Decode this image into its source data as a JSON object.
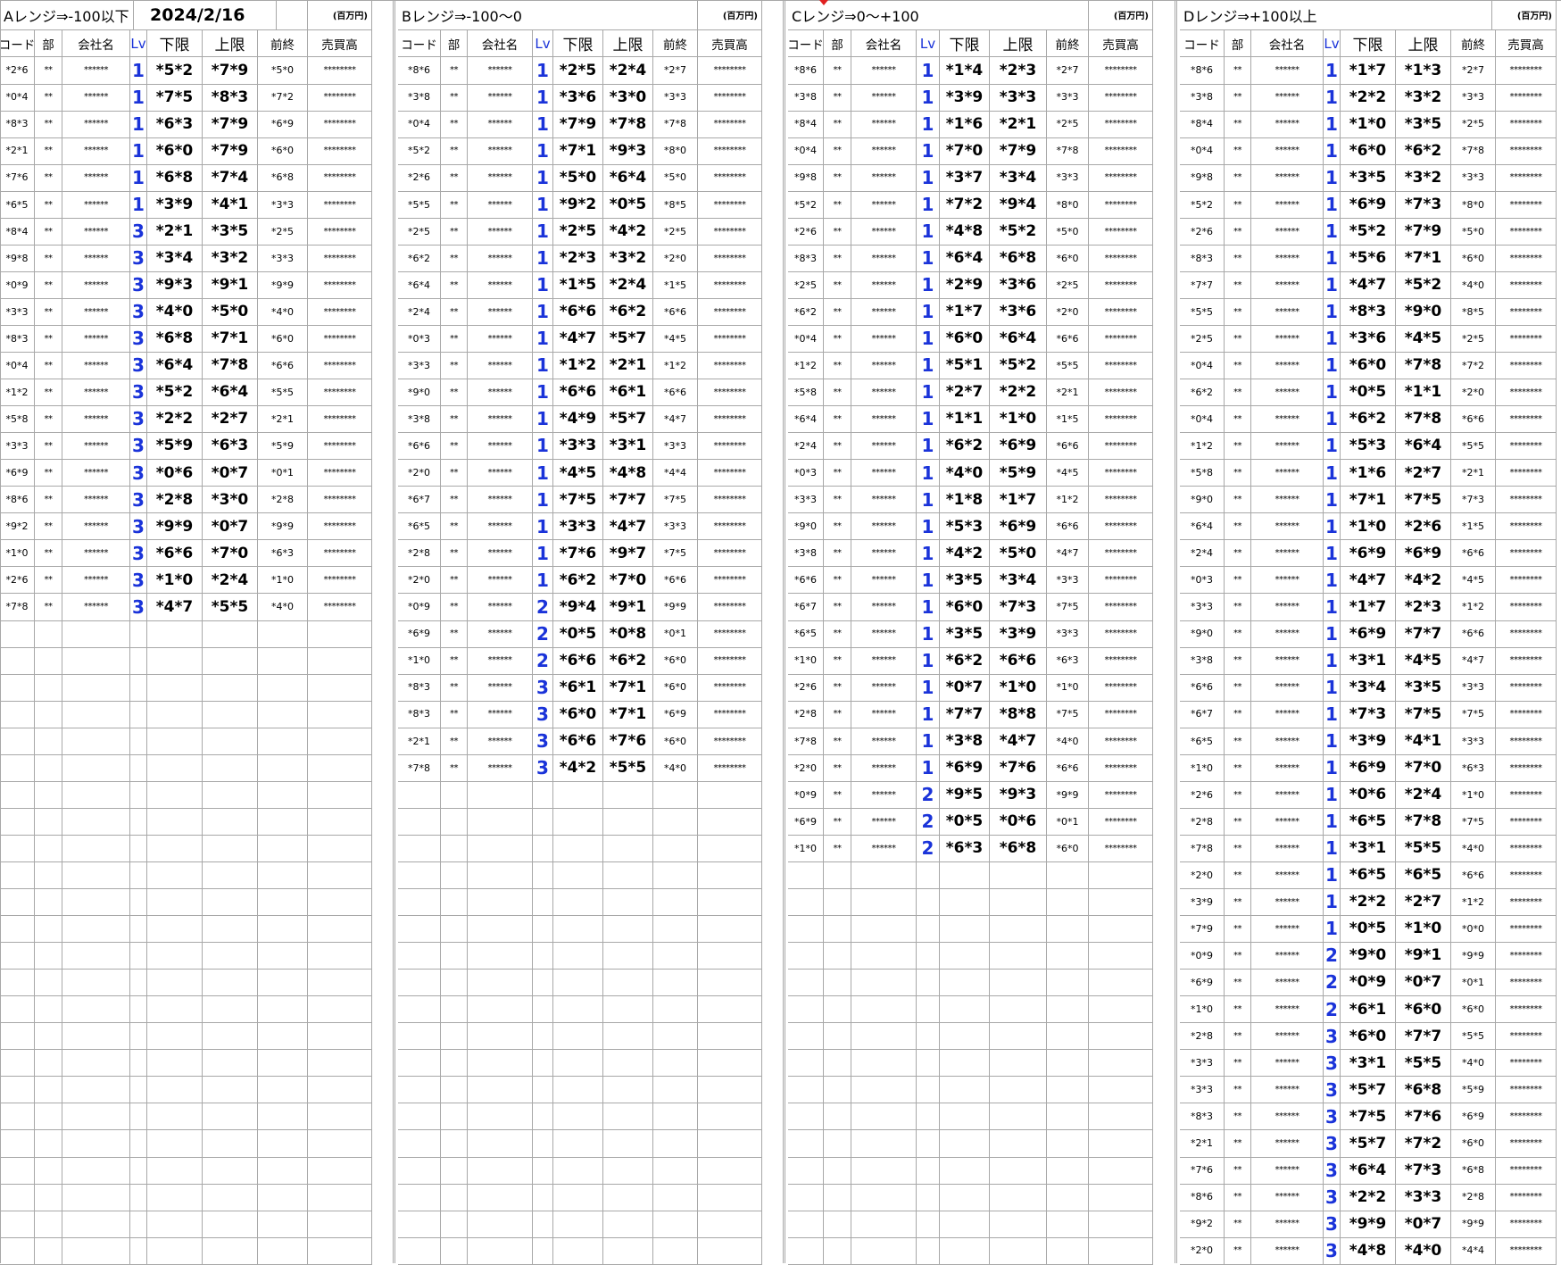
{
  "sheet": {
    "date": "2024/2/16",
    "unit_label": "(百万円)",
    "headers": [
      "コード",
      "部",
      "会社名",
      "Lv",
      "下限",
      "上限",
      "前終",
      "売買高"
    ],
    "mask_company": "******",
    "mask_sector": "**",
    "mask_volume": "********",
    "blocks": [
      {
        "title": "Aレンジ⇒-100以下",
        "rows": [
          [
            "*2*6",
            "1",
            "*5*2",
            "*7*9",
            "*5*0"
          ],
          [
            "*0*4",
            "1",
            "*7*5",
            "*8*3",
            "*7*2"
          ],
          [
            "*8*3",
            "1",
            "*6*3",
            "*7*9",
            "*6*9"
          ],
          [
            "*2*1",
            "1",
            "*6*0",
            "*7*9",
            "*6*0"
          ],
          [
            "*7*6",
            "1",
            "*6*8",
            "*7*4",
            "*6*8"
          ],
          [
            "*6*5",
            "1",
            "*3*9",
            "*4*1",
            "*3*3"
          ],
          [
            "*8*4",
            "3",
            "*2*1",
            "*3*5",
            "*2*5"
          ],
          [
            "*9*8",
            "3",
            "*3*4",
            "*3*2",
            "*3*3"
          ],
          [
            "*0*9",
            "3",
            "*9*3",
            "*9*1",
            "*9*9"
          ],
          [
            "*3*3",
            "3",
            "*4*0",
            "*5*0",
            "*4*0"
          ],
          [
            "*8*3",
            "3",
            "*6*8",
            "*7*1",
            "*6*0"
          ],
          [
            "*0*4",
            "3",
            "*6*4",
            "*7*8",
            "*6*6"
          ],
          [
            "*1*2",
            "3",
            "*5*2",
            "*6*4",
            "*5*5"
          ],
          [
            "*5*8",
            "3",
            "*2*2",
            "*2*7",
            "*2*1"
          ],
          [
            "*3*3",
            "3",
            "*5*9",
            "*6*3",
            "*5*9"
          ],
          [
            "*6*9",
            "3",
            "*0*6",
            "*0*7",
            "*0*1"
          ],
          [
            "*8*6",
            "3",
            "*2*8",
            "*3*0",
            "*2*8"
          ],
          [
            "*9*2",
            "3",
            "*9*9",
            "*0*7",
            "*9*9"
          ],
          [
            "*1*0",
            "3",
            "*6*6",
            "*7*0",
            "*6*3"
          ],
          [
            "*2*6",
            "3",
            "*1*0",
            "*2*4",
            "*1*0"
          ],
          [
            "*7*8",
            "3",
            "*4*7",
            "*5*5",
            "*4*0"
          ]
        ]
      },
      {
        "title": "Bレンジ⇒-100〜0",
        "rows": [
          [
            "*8*6",
            "1",
            "*2*5",
            "*2*4",
            "*2*7"
          ],
          [
            "*3*8",
            "1",
            "*3*6",
            "*3*0",
            "*3*3"
          ],
          [
            "*0*4",
            "1",
            "*7*9",
            "*7*8",
            "*7*8"
          ],
          [
            "*5*2",
            "1",
            "*7*1",
            "*9*3",
            "*8*0"
          ],
          [
            "*2*6",
            "1",
            "*5*0",
            "*6*4",
            "*5*0"
          ],
          [
            "*5*5",
            "1",
            "*9*2",
            "*0*5",
            "*8*5"
          ],
          [
            "*2*5",
            "1",
            "*2*5",
            "*4*2",
            "*2*5"
          ],
          [
            "*6*2",
            "1",
            "*2*3",
            "*3*2",
            "*2*0"
          ],
          [
            "*6*4",
            "1",
            "*1*5",
            "*2*4",
            "*1*5"
          ],
          [
            "*2*4",
            "1",
            "*6*6",
            "*6*2",
            "*6*6"
          ],
          [
            "*0*3",
            "1",
            "*4*7",
            "*5*7",
            "*4*5"
          ],
          [
            "*3*3",
            "1",
            "*1*2",
            "*2*1",
            "*1*2"
          ],
          [
            "*9*0",
            "1",
            "*6*6",
            "*6*1",
            "*6*6"
          ],
          [
            "*3*8",
            "1",
            "*4*9",
            "*5*7",
            "*4*7"
          ],
          [
            "*6*6",
            "1",
            "*3*3",
            "*3*1",
            "*3*3"
          ],
          [
            "*2*0",
            "1",
            "*4*5",
            "*4*8",
            "*4*4"
          ],
          [
            "*6*7",
            "1",
            "*7*5",
            "*7*7",
            "*7*5"
          ],
          [
            "*6*5",
            "1",
            "*3*3",
            "*4*7",
            "*3*3"
          ],
          [
            "*2*8",
            "1",
            "*7*6",
            "*9*7",
            "*7*5"
          ],
          [
            "*2*0",
            "1",
            "*6*2",
            "*7*0",
            "*6*6"
          ],
          [
            "*0*9",
            "2",
            "*9*4",
            "*9*1",
            "*9*9"
          ],
          [
            "*6*9",
            "2",
            "*0*5",
            "*0*8",
            "*0*1"
          ],
          [
            "*1*0",
            "2",
            "*6*6",
            "*6*2",
            "*6*0"
          ],
          [
            "*8*3",
            "3",
            "*6*1",
            "*7*1",
            "*6*0"
          ],
          [
            "*8*3",
            "3",
            "*6*0",
            "*7*1",
            "*6*9"
          ],
          [
            "*2*1",
            "3",
            "*6*6",
            "*7*6",
            "*6*0"
          ],
          [
            "*7*8",
            "3",
            "*4*2",
            "*5*5",
            "*4*0"
          ]
        ]
      },
      {
        "title": "Cレンジ⇒0〜+100",
        "rows": [
          [
            "*8*6",
            "1",
            "*1*4",
            "*2*3",
            "*2*7"
          ],
          [
            "*3*8",
            "1",
            "*3*9",
            "*3*3",
            "*3*3"
          ],
          [
            "*8*4",
            "1",
            "*1*6",
            "*2*1",
            "*2*5"
          ],
          [
            "*0*4",
            "1",
            "*7*0",
            "*7*9",
            "*7*8"
          ],
          [
            "*9*8",
            "1",
            "*3*7",
            "*3*4",
            "*3*3"
          ],
          [
            "*5*2",
            "1",
            "*7*2",
            "*9*4",
            "*8*0"
          ],
          [
            "*2*6",
            "1",
            "*4*8",
            "*5*2",
            "*5*0"
          ],
          [
            "*8*3",
            "1",
            "*6*4",
            "*6*8",
            "*6*0"
          ],
          [
            "*2*5",
            "1",
            "*2*9",
            "*3*6",
            "*2*5"
          ],
          [
            "*6*2",
            "1",
            "*1*7",
            "*3*6",
            "*2*0"
          ],
          [
            "*0*4",
            "1",
            "*6*0",
            "*6*4",
            "*6*6"
          ],
          [
            "*1*2",
            "1",
            "*5*1",
            "*5*2",
            "*5*5"
          ],
          [
            "*5*8",
            "1",
            "*2*7",
            "*2*2",
            "*2*1"
          ],
          [
            "*6*4",
            "1",
            "*1*1",
            "*1*0",
            "*1*5"
          ],
          [
            "*2*4",
            "1",
            "*6*2",
            "*6*9",
            "*6*6"
          ],
          [
            "*0*3",
            "1",
            "*4*0",
            "*5*9",
            "*4*5"
          ],
          [
            "*3*3",
            "1",
            "*1*8",
            "*1*7",
            "*1*2"
          ],
          [
            "*9*0",
            "1",
            "*5*3",
            "*6*9",
            "*6*6"
          ],
          [
            "*3*8",
            "1",
            "*4*2",
            "*5*0",
            "*4*7"
          ],
          [
            "*6*6",
            "1",
            "*3*5",
            "*3*4",
            "*3*3"
          ],
          [
            "*6*7",
            "1",
            "*6*0",
            "*7*3",
            "*7*5"
          ],
          [
            "*6*5",
            "1",
            "*3*5",
            "*3*9",
            "*3*3"
          ],
          [
            "*1*0",
            "1",
            "*6*2",
            "*6*6",
            "*6*3"
          ],
          [
            "*2*6",
            "1",
            "*0*7",
            "*1*0",
            "*1*0"
          ],
          [
            "*2*8",
            "1",
            "*7*7",
            "*8*8",
            "*7*5"
          ],
          [
            "*7*8",
            "1",
            "*3*8",
            "*4*7",
            "*4*0"
          ],
          [
            "*2*0",
            "1",
            "*6*9",
            "*7*6",
            "*6*6"
          ],
          [
            "*0*9",
            "2",
            "*9*5",
            "*9*3",
            "*9*9"
          ],
          [
            "*6*9",
            "2",
            "*0*5",
            "*0*6",
            "*0*1"
          ],
          [
            "*1*0",
            "2",
            "*6*3",
            "*6*8",
            "*6*0"
          ]
        ]
      },
      {
        "title": "Dレンジ⇒+100以上",
        "rows": [
          [
            "*8*6",
            "1",
            "*1*7",
            "*1*3",
            "*2*7"
          ],
          [
            "*3*8",
            "1",
            "*2*2",
            "*3*2",
            "*3*3"
          ],
          [
            "*8*4",
            "1",
            "*1*0",
            "*3*5",
            "*2*5"
          ],
          [
            "*0*4",
            "1",
            "*6*0",
            "*6*2",
            "*7*8"
          ],
          [
            "*9*8",
            "1",
            "*3*5",
            "*3*2",
            "*3*3"
          ],
          [
            "*5*2",
            "1",
            "*6*9",
            "*7*3",
            "*8*0"
          ],
          [
            "*2*6",
            "1",
            "*5*2",
            "*7*9",
            "*5*0"
          ],
          [
            "*8*3",
            "1",
            "*5*6",
            "*7*1",
            "*6*0"
          ],
          [
            "*7*7",
            "1",
            "*4*7",
            "*5*2",
            "*4*0"
          ],
          [
            "*5*5",
            "1",
            "*8*3",
            "*9*0",
            "*8*5"
          ],
          [
            "*2*5",
            "1",
            "*3*6",
            "*4*5",
            "*2*5"
          ],
          [
            "*0*4",
            "1",
            "*6*0",
            "*7*8",
            "*7*2"
          ],
          [
            "*6*2",
            "1",
            "*0*5",
            "*1*1",
            "*2*0"
          ],
          [
            "*0*4",
            "1",
            "*6*2",
            "*7*8",
            "*6*6"
          ],
          [
            "*1*2",
            "1",
            "*5*3",
            "*6*4",
            "*5*5"
          ],
          [
            "*5*8",
            "1",
            "*1*6",
            "*2*7",
            "*2*1"
          ],
          [
            "*9*0",
            "1",
            "*7*1",
            "*7*5",
            "*7*3"
          ],
          [
            "*6*4",
            "1",
            "*1*0",
            "*2*6",
            "*1*5"
          ],
          [
            "*2*4",
            "1",
            "*6*9",
            "*6*9",
            "*6*6"
          ],
          [
            "*0*3",
            "1",
            "*4*7",
            "*4*2",
            "*4*5"
          ],
          [
            "*3*3",
            "1",
            "*1*7",
            "*2*3",
            "*1*2"
          ],
          [
            "*9*0",
            "1",
            "*6*9",
            "*7*7",
            "*6*6"
          ],
          [
            "*3*8",
            "1",
            "*3*1",
            "*4*5",
            "*4*7"
          ],
          [
            "*6*6",
            "1",
            "*3*4",
            "*3*5",
            "*3*3"
          ],
          [
            "*6*7",
            "1",
            "*7*3",
            "*7*5",
            "*7*5"
          ],
          [
            "*6*5",
            "1",
            "*3*9",
            "*4*1",
            "*3*3"
          ],
          [
            "*1*0",
            "1",
            "*6*9",
            "*7*0",
            "*6*3"
          ],
          [
            "*2*6",
            "1",
            "*0*6",
            "*2*4",
            "*1*0"
          ],
          [
            "*2*8",
            "1",
            "*6*5",
            "*7*8",
            "*7*5"
          ],
          [
            "*7*8",
            "1",
            "*3*1",
            "*5*5",
            "*4*0"
          ],
          [
            "*2*0",
            "1",
            "*6*5",
            "*6*5",
            "*6*6"
          ],
          [
            "*3*9",
            "1",
            "*2*2",
            "*2*7",
            "*1*2"
          ],
          [
            "*7*9",
            "1",
            "*0*5",
            "*1*0",
            "*0*0"
          ],
          [
            "*0*9",
            "2",
            "*9*0",
            "*9*1",
            "*9*9"
          ],
          [
            "*6*9",
            "2",
            "*0*9",
            "*0*7",
            "*0*1"
          ],
          [
            "*1*0",
            "2",
            "*6*1",
            "*6*0",
            "*6*0"
          ],
          [
            "*2*8",
            "3",
            "*6*0",
            "*7*7",
            "*5*5"
          ],
          [
            "*3*3",
            "3",
            "*3*1",
            "*5*5",
            "*4*0"
          ],
          [
            "*3*3",
            "3",
            "*5*7",
            "*6*8",
            "*5*9"
          ],
          [
            "*8*3",
            "3",
            "*7*5",
            "*7*6",
            "*6*9"
          ],
          [
            "*2*1",
            "3",
            "*5*7",
            "*7*2",
            "*6*0"
          ],
          [
            "*7*6",
            "3",
            "*6*4",
            "*7*3",
            "*6*8"
          ],
          [
            "*8*6",
            "3",
            "*2*2",
            "*3*3",
            "*2*8"
          ],
          [
            "*9*2",
            "3",
            "*9*9",
            "*0*7",
            "*9*9"
          ],
          [
            "*2*0",
            "3",
            "*4*8",
            "*4*0",
            "*4*4"
          ]
        ]
      }
    ]
  }
}
